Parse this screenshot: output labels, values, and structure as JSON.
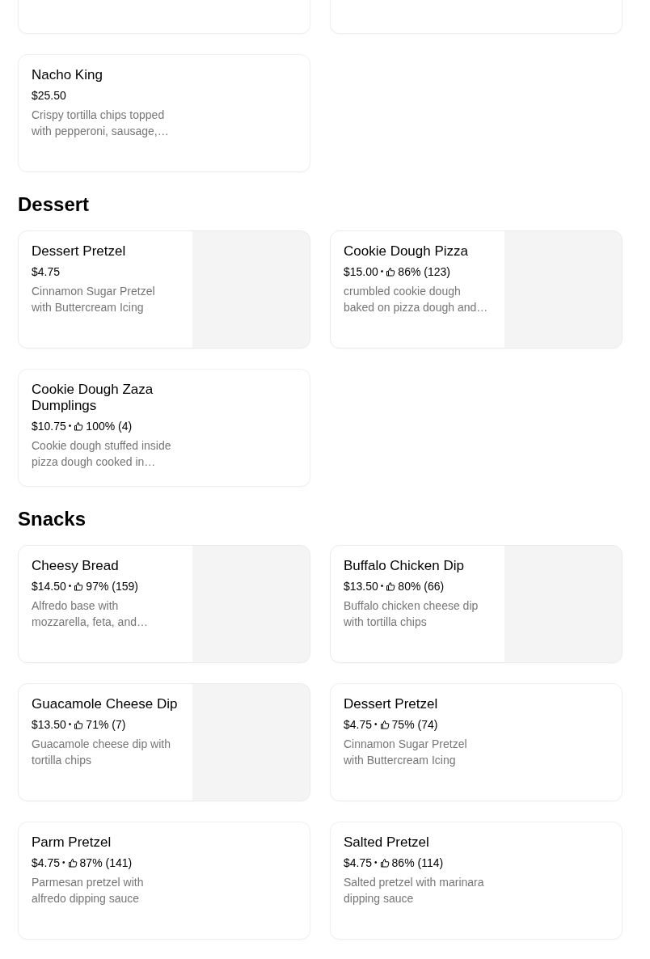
{
  "sections": [
    {
      "items": [
        {
          "kind": "text",
          "name": "Nacho King",
          "price": "$25.50",
          "description": "Crispy tortilla chips topped with pepperoni, sausage,…"
        }
      ]
    },
    {
      "heading": "Dessert",
      "items": [
        {
          "kind": "photo",
          "name": "Dessert Pretzel",
          "price": "$4.75",
          "description": "Cinnamon Sugar Pretzel with Buttercream Icing"
        },
        {
          "kind": "photo",
          "name": "Cookie Dough Pizza",
          "price": "$15.00",
          "separator": "•",
          "rating": "86% (123)",
          "description": "crumbled cookie dough baked on pizza dough and…"
        },
        {
          "kind": "text",
          "name": "Cookie Dough Zaza Dumplings",
          "price": "$10.75",
          "separator": "•",
          "rating": "100% (4)",
          "description": "Cookie dough stuffed inside pizza dough cooked in…"
        }
      ]
    },
    {
      "heading": "Snacks",
      "items": [
        {
          "kind": "photo",
          "name": "Cheesy Bread",
          "price": "$14.50",
          "separator": "•",
          "rating": "97% (159)",
          "description": "Alfredo base with mozzarella, feta, and…"
        },
        {
          "kind": "photo",
          "name": "Buffalo Chicken Dip",
          "price": "$13.50",
          "separator": "•",
          "rating": "80% (66)",
          "description": "Buffalo chicken cheese dip with tortilla chips"
        },
        {
          "kind": "photo",
          "name": "Guacamole Cheese Dip",
          "price": "$13.50",
          "separator": "•",
          "rating": "71% (7)",
          "description": "Guacamole cheese dip with tortilla chips"
        },
        {
          "kind": "text",
          "name": "Dessert Pretzel",
          "price": "$4.75",
          "separator": "•",
          "rating": "75% (74)",
          "description": "Cinnamon Sugar Pretzel with Buttercream Icing"
        },
        {
          "kind": "text",
          "name": "Parm Pretzel",
          "price": "$4.75",
          "separator": "•",
          "rating": "87% (141)",
          "description": "Parmesan pretzel with alfredo dipping sauce"
        },
        {
          "kind": "text",
          "name": "Salted Pretzel",
          "price": "$4.75",
          "separator": "•",
          "rating": "86% (114)",
          "description": "Salted pretzel with marinara dipping sauce"
        }
      ]
    }
  ]
}
